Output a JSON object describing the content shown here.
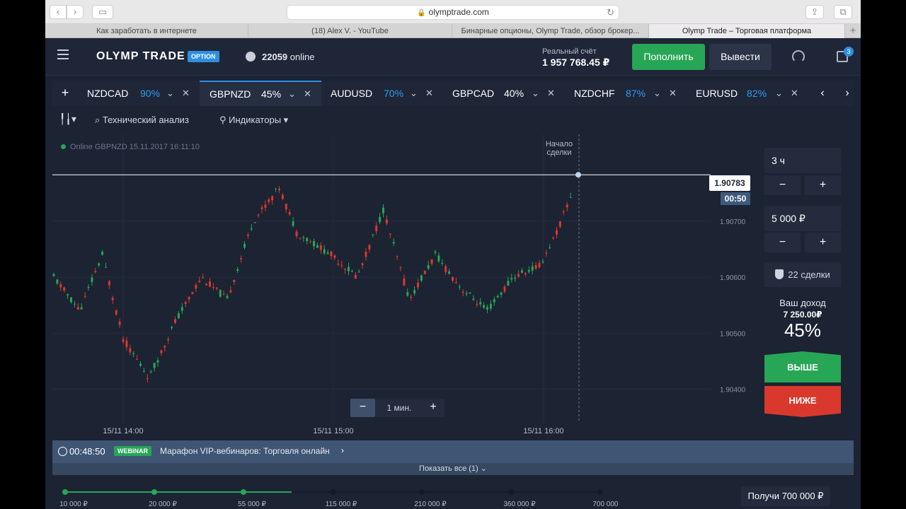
{
  "browser": {
    "url": "olymptrade.com",
    "tabs": [
      {
        "label": "Как заработать в интернете",
        "active": false
      },
      {
        "label": "(18) Alex V. - YouTube",
        "active": false
      },
      {
        "label": "Бинарные опционы, Olymp Trade, обзор брокер...",
        "active": false
      },
      {
        "label": "Olymp Trade – Торговая платформа",
        "active": true
      }
    ]
  },
  "header": {
    "logo": "OLYMP TRADE",
    "logo_badge": "OPTION",
    "online_count": "22059",
    "online_label": "online",
    "account_label": "Реальный счёт",
    "account_balance": "1 957 768.45 ₽",
    "deposit_label": "Пополнить",
    "withdraw_label": "Вывести",
    "portfolio_badge": "3"
  },
  "assets": [
    {
      "symbol": "NZDCAD",
      "pct": "90%",
      "active": false,
      "pct_color": "#2e9bf0"
    },
    {
      "symbol": "GBPNZD",
      "pct": "45%",
      "active": true,
      "pct_color": "#ffffff"
    },
    {
      "symbol": "AUDUSD",
      "pct": "70%",
      "active": false,
      "pct_color": "#2e9bf0"
    },
    {
      "symbol": "GBPCAD",
      "pct": "40%",
      "active": false,
      "pct_color": "#ffffff"
    },
    {
      "symbol": "NZDCHF",
      "pct": "87%",
      "active": false,
      "pct_color": "#2e9bf0"
    },
    {
      "symbol": "EURUSD",
      "pct": "82%",
      "active": false,
      "pct_color": "#2e9bf0"
    }
  ],
  "chart_tools": {
    "technical_analysis": "Технический анализ",
    "indicators": "Индикаторы"
  },
  "chart_status": "Online GBPNZD  15.11.2017 16:11:10",
  "deal_start_label_1": "Начало",
  "deal_start_label_2": "сделки",
  "current_price": "1.90783",
  "timer": "00:50",
  "zoom_label": "1 мин.",
  "chart_data": {
    "type": "candlestick",
    "symbol": "GBPNZD",
    "y_ticks": [
      "1.90700",
      "1.90600",
      "1.90500",
      "1.90400"
    ],
    "x_ticks": [
      "15/11 14:00",
      "15/11 15:00",
      "15/11 16:00"
    ],
    "ylim": [
      1.9035,
      1.9083
    ],
    "current_price": 1.90783,
    "colors": {
      "up": "#27a656",
      "down": "#d9392d",
      "grid": "#262e42"
    }
  },
  "panel": {
    "duration": "3 ч",
    "amount": "5 000 ₽",
    "deals": "22 сделки",
    "income_label": "Ваш доход",
    "income_value": "7 250.00₽",
    "income_pct": "45%",
    "up_label": "ВЫШЕ",
    "down_label": "НИЖЕ"
  },
  "webinar": {
    "timer": "00:48:50",
    "badge": "WEBINAR",
    "title": "Марафон VIP-вебинаров: Торговля онлайн",
    "show_all": "Показать все (1)"
  },
  "progress": {
    "levels": [
      "10 000 ₽",
      "20 000 ₽",
      "55 000 ₽",
      "115 000 ₽",
      "210 000 ₽",
      "360 000 ₽",
      "700 000 ₽"
    ],
    "completed": 3,
    "cta": "Получи 700 000 ₽"
  }
}
